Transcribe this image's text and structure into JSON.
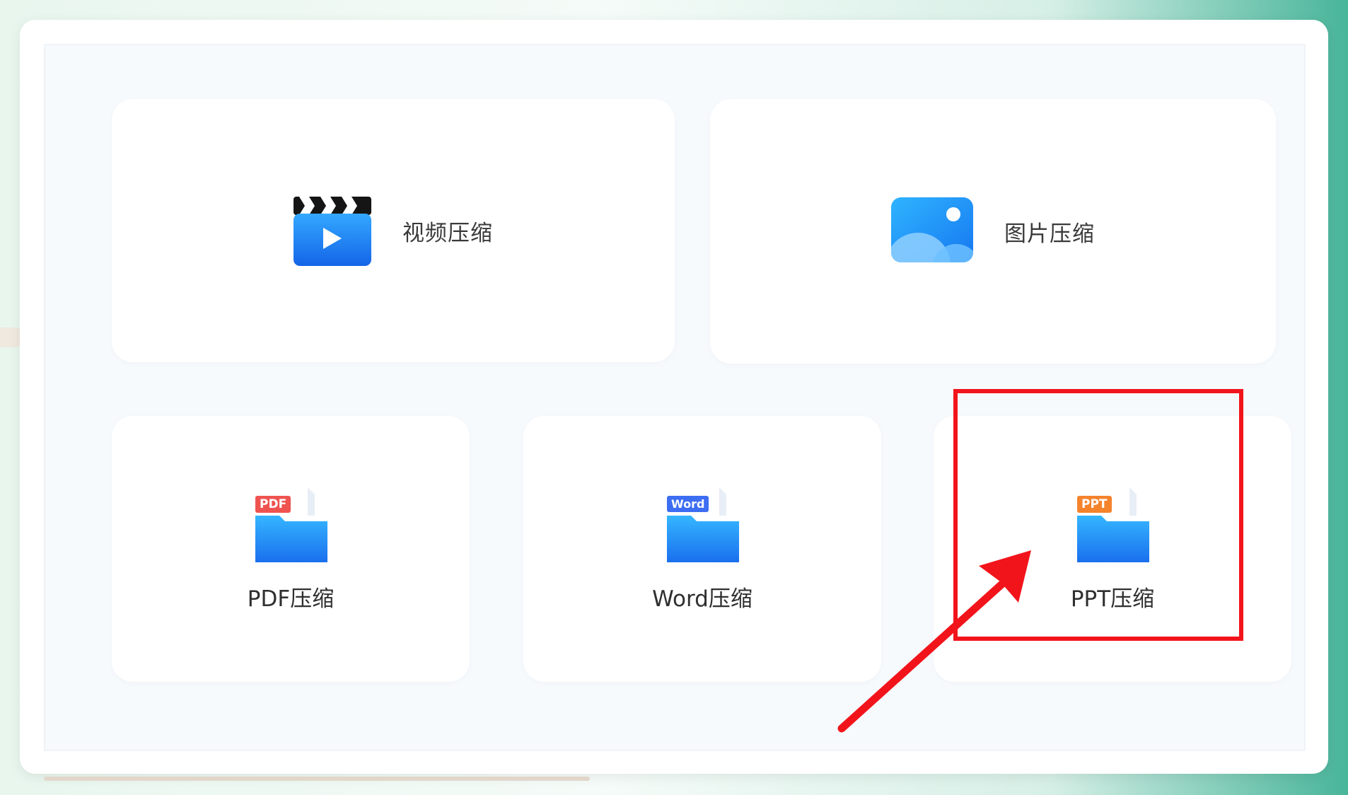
{
  "colors": {
    "accent_blue": "#1f87f5",
    "annotation_red": "#f2141b",
    "pdf_badge": "#ef5350",
    "word_badge": "#3d6df2",
    "ppt_badge": "#f5832c"
  },
  "cards": {
    "video": {
      "label": "视频压缩",
      "icon": "video-clapper-icon"
    },
    "image": {
      "label": "图片压缩",
      "icon": "image-icon"
    },
    "pdf": {
      "label": "PDF压缩",
      "badge": "PDF",
      "icon": "pdf-folder-icon"
    },
    "word": {
      "label": "Word压缩",
      "badge": "Word",
      "icon": "word-folder-icon"
    },
    "ppt": {
      "label": "PPT压缩",
      "badge": "PPT",
      "icon": "ppt-folder-icon"
    }
  },
  "annotation": {
    "target": "ppt",
    "shapes": [
      "rectangle",
      "arrow"
    ]
  }
}
